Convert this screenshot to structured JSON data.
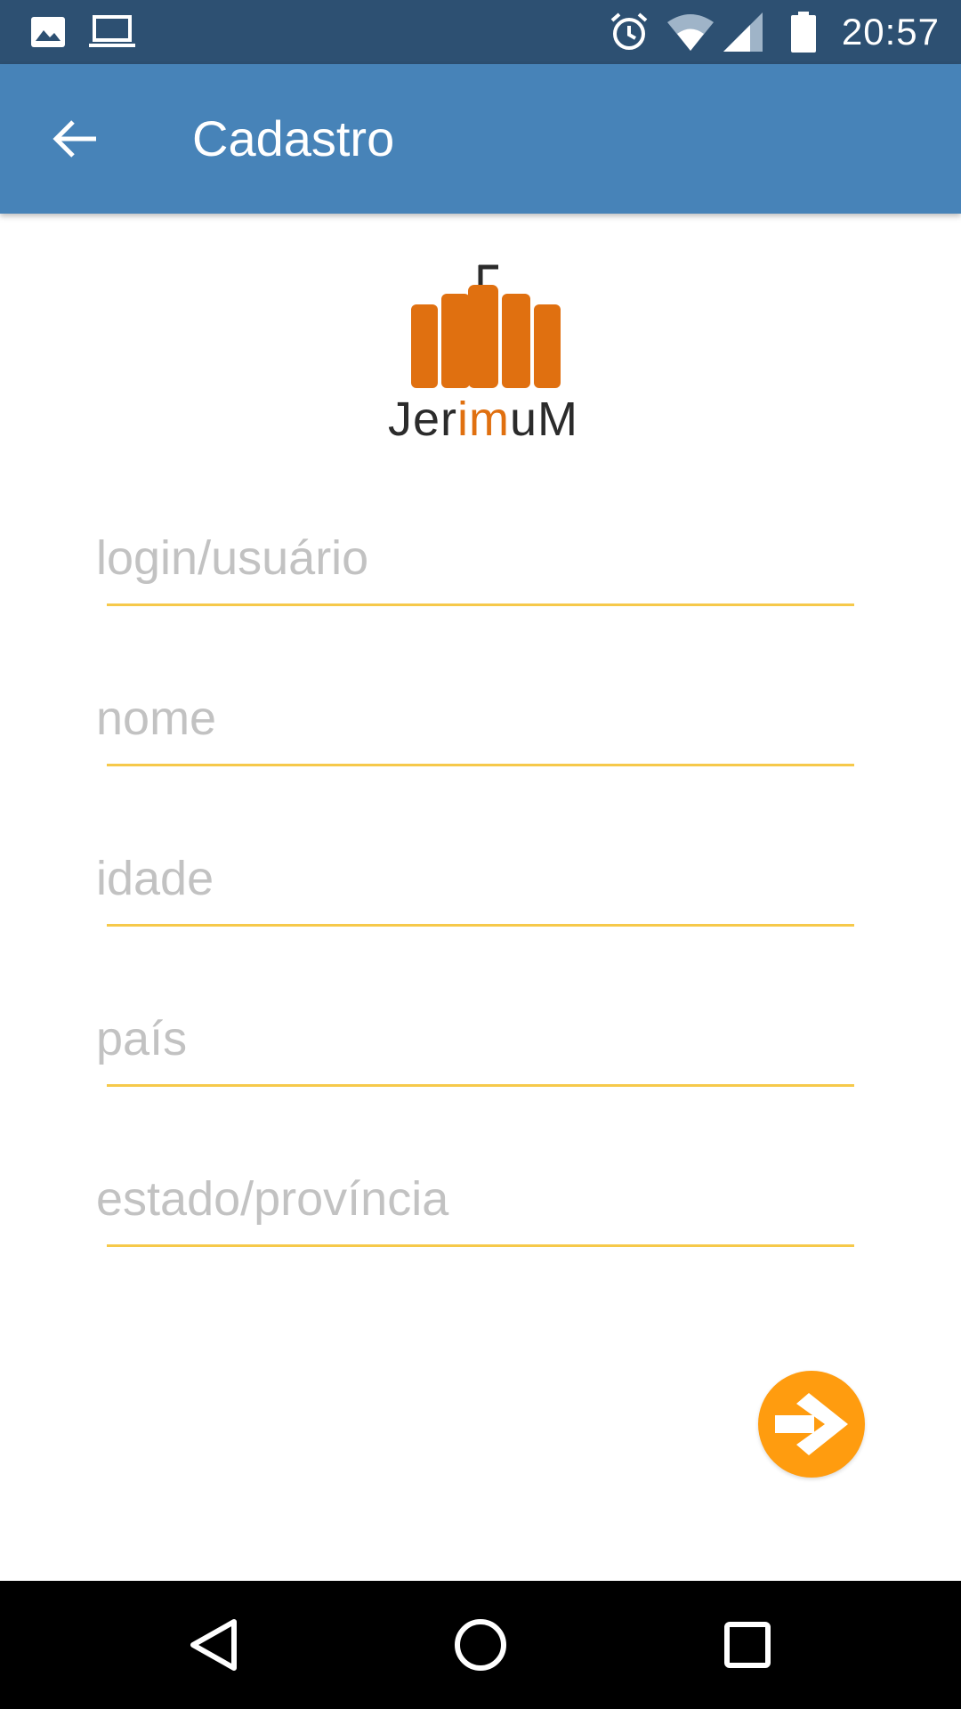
{
  "status_bar": {
    "time": "20:57",
    "icons": [
      "image-icon",
      "laptop-icon",
      "alarm-icon",
      "wifi-icon",
      "signal-icon",
      "battery-icon"
    ]
  },
  "app_bar": {
    "title": "Cadastro",
    "back_icon": "arrow-left-icon"
  },
  "logo": {
    "text_part1": "Jer",
    "text_accent": "im",
    "text_part2": "uM",
    "colors": {
      "primary": "#e07010",
      "dark": "#2b2b2b"
    }
  },
  "form": {
    "fields": [
      {
        "name": "login",
        "placeholder": "login/usuário",
        "value": ""
      },
      {
        "name": "nome",
        "placeholder": "nome",
        "value": ""
      },
      {
        "name": "idade",
        "placeholder": "idade",
        "value": ""
      },
      {
        "name": "pais",
        "placeholder": "país",
        "value": ""
      },
      {
        "name": "estado",
        "placeholder": "estado/província",
        "value": ""
      }
    ],
    "underline_color": "#f6c94a"
  },
  "fab": {
    "icon": "arrow-right-circle-icon",
    "color": "#ff9c0f"
  },
  "nav_bar": {
    "buttons": [
      "back-triangle-icon",
      "home-circle-icon",
      "recents-square-icon"
    ]
  },
  "colors": {
    "status_bar": "#2d5072",
    "app_bar": "#4783b8",
    "background": "#ffffff"
  }
}
